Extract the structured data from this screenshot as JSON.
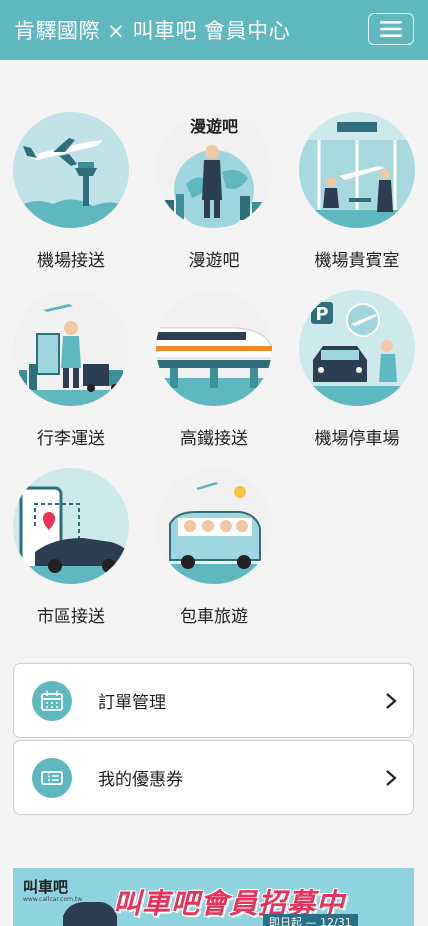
{
  "header": {
    "title": "肯驛國際 × 叫車吧 會員中心"
  },
  "services": [
    {
      "id": "airport-transfer",
      "label": "機場接送",
      "icon": "airplane-tower-icon"
    },
    {
      "id": "roaming",
      "label": "漫遊吧",
      "icon": "roaming-globe-icon",
      "badge": "漫遊吧"
    },
    {
      "id": "airport-lounge",
      "label": "機場貴賓室",
      "icon": "lounge-icon"
    },
    {
      "id": "luggage",
      "label": "行李運送",
      "icon": "luggage-truck-icon"
    },
    {
      "id": "hsr-transfer",
      "label": "高鐵接送",
      "icon": "high-speed-rail-icon"
    },
    {
      "id": "airport-parking",
      "label": "機場停車場",
      "icon": "parking-car-icon"
    },
    {
      "id": "city-transfer",
      "label": "市區接送",
      "icon": "city-car-map-icon"
    },
    {
      "id": "charter-tour",
      "label": "包車旅遊",
      "icon": "charter-van-icon"
    }
  ],
  "rows": [
    {
      "label": "訂單管理",
      "icon": "calendar-icon"
    },
    {
      "label": "我的優惠券",
      "icon": "coupon-icon"
    }
  ],
  "banner": {
    "brand": "叫車吧",
    "brand_sub": "www.callcar.com.tw",
    "headline": "叫車吧會員招募中",
    "subline": "即日起 — 12/31"
  },
  "colors": {
    "teal": "#5fb7bf",
    "background": "#f4f4f4",
    "accent_pink": "#e8325a"
  }
}
